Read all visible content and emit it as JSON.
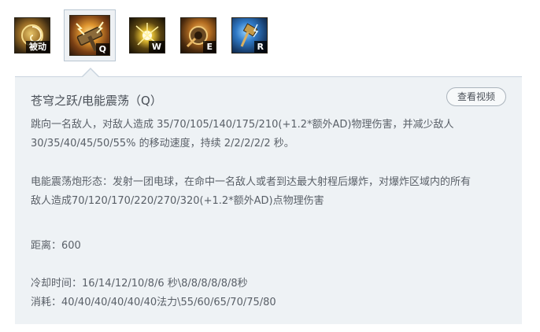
{
  "skills": [
    {
      "key": "被动",
      "icon": "passive-spiral-icon",
      "selected": false
    },
    {
      "key": "Q",
      "icon": "electric-hammer-icon",
      "selected": true
    },
    {
      "key": "W",
      "icon": "lightning-orb-icon",
      "selected": false
    },
    {
      "key": "E",
      "icon": "golden-cannon-icon",
      "selected": false
    },
    {
      "key": "R",
      "icon": "blue-hammer-icon",
      "selected": false
    }
  ],
  "detail": {
    "title": "苍穹之跃/电能震荡（Q）",
    "video_button": "查看视频",
    "desc1_line1": "跳向一名敌人，对敌人造成 35/70/105/140/175/210(+1.2*额外AD)物理伤害，并减少敌人",
    "desc1_line2": "30/35/40/45/50/55% 的移动速度，持续 2/2/2/2/2 秒。",
    "desc2_line1": "电能震荡炮形态：发射一团电球，在命中一名敌人或者到达最大射程后爆炸，对爆炸区域内的所有",
    "desc2_line2": "敌人造成70/120/170/220/270/320(+1.2*额外AD)点物理伤害",
    "range": "距离：600",
    "cooldown": "冷却时间：16/14/12/10/8/6 秒\\8/8/8/8/8/8秒",
    "cost": "消耗：40/40/40/40/40/40法力\\55/60/65/70/75/80"
  },
  "colors": {
    "panel_bg": "#eef2f5",
    "panel_border": "#c9d4de",
    "text": "#5a6068"
  }
}
